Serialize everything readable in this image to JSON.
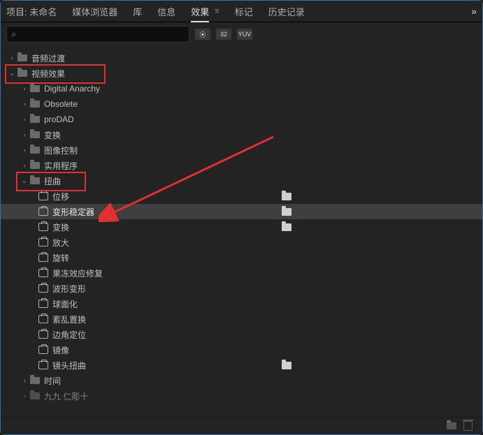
{
  "tabs": {
    "project": "项目: 未命名",
    "media_browser": "媒体浏览器",
    "library": "库",
    "info": "信息",
    "effects": "效果",
    "markers": "标记",
    "history": "历史记录",
    "expand": "»"
  },
  "search": {
    "placeholder": ""
  },
  "badges": {
    "fx": "⦿",
    "b32": "32",
    "yuv": "YUV"
  },
  "tree": {
    "audio_transitions": "音频过渡",
    "video_effects": "视频效果",
    "digital_anarchy": "Digital Anarchy",
    "obsolete": "Obsolete",
    "prodad": "proDAD",
    "transform_folder": "变换",
    "image_control": "图像控制",
    "utility": "实用程序",
    "distort": "扭曲",
    "distort_items": {
      "offset": "位移",
      "warp_stabilizer": "变形稳定器",
      "transform": "变换",
      "magnify": "放大",
      "twirl": "旋转",
      "rolling_shutter": "果冻效应修复",
      "wave_warp": "波形变形",
      "spherize": "球面化",
      "turbulent_displace": "紊乱置换",
      "corner_pin": "边角定位",
      "mirror": "镜像",
      "lens_distortion": "镜头扭曲"
    },
    "time": "时间",
    "truncated": "九九 仁彫十"
  }
}
